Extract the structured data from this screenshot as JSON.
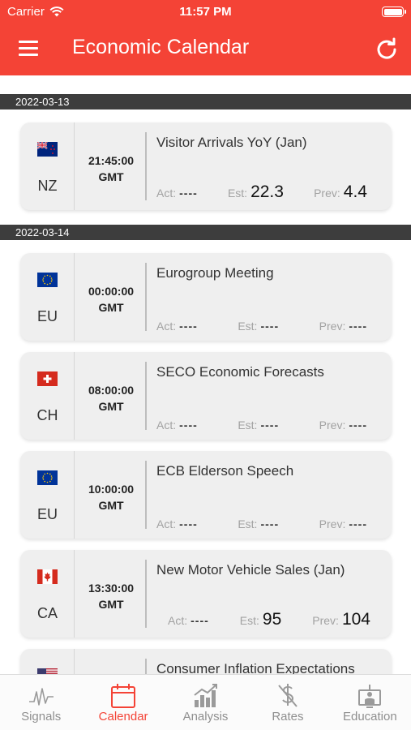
{
  "status_bar": {
    "carrier": "Carrier",
    "time": "11:57 PM"
  },
  "header": {
    "title": "Economic Calendar"
  },
  "labels": {
    "actual": "Act:",
    "estimate": "Est:",
    "previous": "Prev:"
  },
  "sections": [
    {
      "date": "2022-03-13",
      "events": [
        {
          "country": "NZ",
          "flag": "nz-flag-icon",
          "time": "21:45:00",
          "tz": "GMT",
          "name": "Visitor Arrivals YoY (Jan)",
          "actual": "----",
          "estimate": "22.3",
          "previous": "4.4"
        }
      ]
    },
    {
      "date": "2022-03-14",
      "events": [
        {
          "country": "EU",
          "flag": "eu-flag-icon",
          "time": "00:00:00",
          "tz": "GMT",
          "name": "Eurogroup Meeting",
          "actual": "----",
          "estimate": "----",
          "previous": "----"
        },
        {
          "country": "CH",
          "flag": "ch-flag-icon",
          "time": "08:00:00",
          "tz": "GMT",
          "name": "SECO Economic Forecasts",
          "actual": "----",
          "estimate": "----",
          "previous": "----"
        },
        {
          "country": "EU",
          "flag": "eu-flag-icon",
          "time": "10:00:00",
          "tz": "GMT",
          "name": "ECB Elderson Speech",
          "actual": "----",
          "estimate": "----",
          "previous": "----"
        },
        {
          "country": "CA",
          "flag": "ca-flag-icon",
          "time": "13:30:00",
          "tz": "GMT",
          "name": "New Motor Vehicle Sales (Jan)",
          "actual": "----",
          "estimate": "95",
          "previous": "104"
        },
        {
          "country": "US",
          "flag": "us-flag-icon",
          "name": "Consumer Inflation Expectations"
        }
      ]
    }
  ],
  "tabbar": {
    "active": "Calendar",
    "tabs": [
      {
        "label": "Signals",
        "icon": "signals-icon"
      },
      {
        "label": "Calendar",
        "icon": "calendar-icon"
      },
      {
        "label": "Analysis",
        "icon": "analysis-icon"
      },
      {
        "label": "Rates",
        "icon": "rates-icon"
      },
      {
        "label": "Education",
        "icon": "education-icon"
      }
    ]
  },
  "colors": {
    "accent": "#f44336",
    "date_bar": "#3d3d3d",
    "card": "#efefef",
    "inactive_tab": "#8f8f8f"
  }
}
